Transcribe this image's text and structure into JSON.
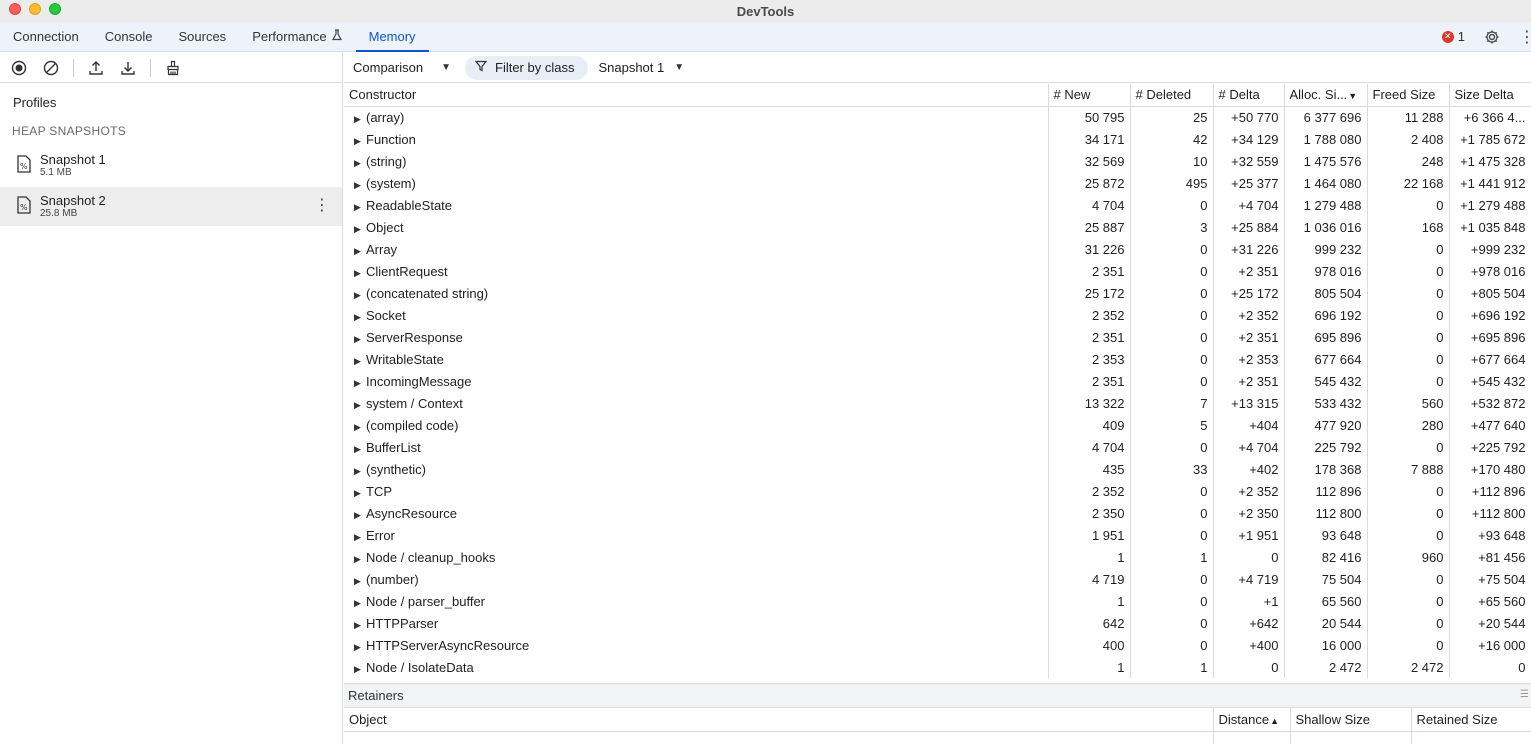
{
  "window": {
    "title": "DevTools"
  },
  "tabs": [
    {
      "label": "Connection"
    },
    {
      "label": "Console"
    },
    {
      "label": "Sources"
    },
    {
      "label": "Performance"
    },
    {
      "label": "Memory"
    }
  ],
  "active_tab": "Memory",
  "error_count": "1",
  "sidebar": {
    "profiles_label": "Profiles",
    "section_label": "HEAP SNAPSHOTS",
    "snapshots": [
      {
        "name": "Snapshot 1",
        "size": "5.1 MB"
      },
      {
        "name": "Snapshot 2",
        "size": "25.8 MB"
      }
    ]
  },
  "toolbar": {
    "view_mode": "Comparison",
    "filter_label": "Filter by class",
    "base_snapshot": "Snapshot 1"
  },
  "table": {
    "columns": [
      "Constructor",
      "# New",
      "# Deleted",
      "# Delta",
      "Alloc. Si...",
      "Freed Size",
      "Size Delta"
    ],
    "sort_column": "Alloc. Si...",
    "rows": [
      [
        "(array)",
        "50 795",
        "25",
        "+50 770",
        "6 377 696",
        "11 288",
        "+6 366 4..."
      ],
      [
        "Function",
        "34 171",
        "42",
        "+34 129",
        "1 788 080",
        "2 408",
        "+1 785 672"
      ],
      [
        "(string)",
        "32 569",
        "10",
        "+32 559",
        "1 475 576",
        "248",
        "+1 475 328"
      ],
      [
        "(system)",
        "25 872",
        "495",
        "+25 377",
        "1 464 080",
        "22 168",
        "+1 441 912"
      ],
      [
        "ReadableState",
        "4 704",
        "0",
        "+4 704",
        "1 279 488",
        "0",
        "+1 279 488"
      ],
      [
        "Object",
        "25 887",
        "3",
        "+25 884",
        "1 036 016",
        "168",
        "+1 035 848"
      ],
      [
        "Array",
        "31 226",
        "0",
        "+31 226",
        "999 232",
        "0",
        "+999 232"
      ],
      [
        "ClientRequest",
        "2 351",
        "0",
        "+2 351",
        "978 016",
        "0",
        "+978 016"
      ],
      [
        "(concatenated string)",
        "25 172",
        "0",
        "+25 172",
        "805 504",
        "0",
        "+805 504"
      ],
      [
        "Socket",
        "2 352",
        "0",
        "+2 352",
        "696 192",
        "0",
        "+696 192"
      ],
      [
        "ServerResponse",
        "2 351",
        "0",
        "+2 351",
        "695 896",
        "0",
        "+695 896"
      ],
      [
        "WritableState",
        "2 353",
        "0",
        "+2 353",
        "677 664",
        "0",
        "+677 664"
      ],
      [
        "IncomingMessage",
        "2 351",
        "0",
        "+2 351",
        "545 432",
        "0",
        "+545 432"
      ],
      [
        "system / Context",
        "13 322",
        "7",
        "+13 315",
        "533 432",
        "560",
        "+532 872"
      ],
      [
        "(compiled code)",
        "409",
        "5",
        "+404",
        "477 920",
        "280",
        "+477 640"
      ],
      [
        "BufferList",
        "4 704",
        "0",
        "+4 704",
        "225 792",
        "0",
        "+225 792"
      ],
      [
        "(synthetic)",
        "435",
        "33",
        "+402",
        "178 368",
        "7 888",
        "+170 480"
      ],
      [
        "TCP",
        "2 352",
        "0",
        "+2 352",
        "112 896",
        "0",
        "+112 896"
      ],
      [
        "AsyncResource",
        "2 350",
        "0",
        "+2 350",
        "112 800",
        "0",
        "+112 800"
      ],
      [
        "Error",
        "1 951",
        "0",
        "+1 951",
        "93 648",
        "0",
        "+93 648"
      ],
      [
        "Node / cleanup_hooks",
        "1",
        "1",
        "0",
        "82 416",
        "960",
        "+81 456"
      ],
      [
        "(number)",
        "4 719",
        "0",
        "+4 719",
        "75 504",
        "0",
        "+75 504"
      ],
      [
        "Node / parser_buffer",
        "1",
        "0",
        "+1",
        "65 560",
        "0",
        "+65 560"
      ],
      [
        "HTTPParser",
        "642",
        "0",
        "+642",
        "20 544",
        "0",
        "+20 544"
      ],
      [
        "HTTPServerAsyncResource",
        "400",
        "0",
        "+400",
        "16 000",
        "0",
        "+16 000"
      ],
      [
        "Node / IsolateData",
        "1",
        "1",
        "0",
        "2 472",
        "2 472",
        "0"
      ]
    ]
  },
  "retainers": {
    "title": "Retainers",
    "columns": [
      "Object",
      "Distance",
      "Shallow Size",
      "Retained Size"
    ],
    "sort_column": "Distance"
  },
  "colors": {
    "accent": "#0b57d0",
    "tabbar_bg": "#eef3fb",
    "error": "#dc362e"
  },
  "icons": {
    "record": "record-icon",
    "clear": "clear-icon",
    "upload": "upload-icon",
    "download": "download-icon",
    "gc": "broom-icon",
    "filter": "filter-icon",
    "settings": "gear-icon",
    "performance_tab": "flask-icon"
  }
}
